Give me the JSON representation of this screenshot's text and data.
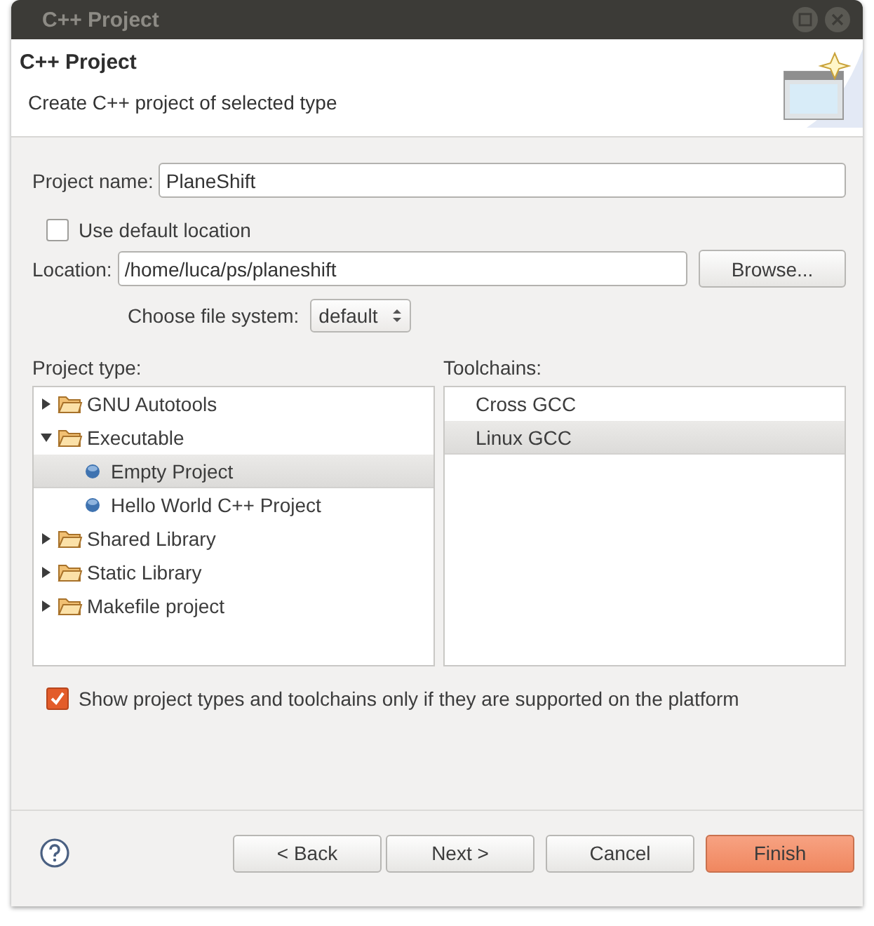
{
  "window": {
    "title": "C++ Project"
  },
  "header": {
    "title": "C++ Project",
    "description": "Create C++ project of selected type"
  },
  "project_name": {
    "label": "Project name:",
    "value": "PlaneShift"
  },
  "use_default_location": {
    "label": "Use default location",
    "checked": false
  },
  "location": {
    "label": "Location:",
    "value": "/home/luca/ps/planeshift",
    "button": "Browse..."
  },
  "file_system": {
    "label": "Choose file system:",
    "value": "default"
  },
  "project_type": {
    "label": "Project type:",
    "items": [
      {
        "label": "GNU Autotools",
        "kind": "folder",
        "expanded": false,
        "selected": false
      },
      {
        "label": "Executable",
        "kind": "folder",
        "expanded": true,
        "selected": false,
        "children": [
          {
            "label": "Empty Project",
            "kind": "template",
            "selected": true
          },
          {
            "label": "Hello World C++ Project",
            "kind": "template",
            "selected": false
          }
        ]
      },
      {
        "label": "Shared Library",
        "kind": "folder",
        "expanded": false,
        "selected": false
      },
      {
        "label": "Static Library",
        "kind": "folder",
        "expanded": false,
        "selected": false
      },
      {
        "label": "Makefile project",
        "kind": "folder",
        "expanded": false,
        "selected": false
      }
    ]
  },
  "toolchains": {
    "label": "Toolchains:",
    "items": [
      {
        "label": "Cross GCC",
        "selected": false
      },
      {
        "label": "Linux GCC",
        "selected": true
      }
    ]
  },
  "show_supported_only": {
    "label": "Show project types and toolchains only if they are supported on the platform",
    "checked": true
  },
  "buttons": [
    {
      "label": "< Back",
      "primary": false
    },
    {
      "label": "Next >",
      "primary": false
    },
    {
      "label": "Cancel",
      "primary": false
    },
    {
      "label": "Finish",
      "primary": true
    }
  ]
}
